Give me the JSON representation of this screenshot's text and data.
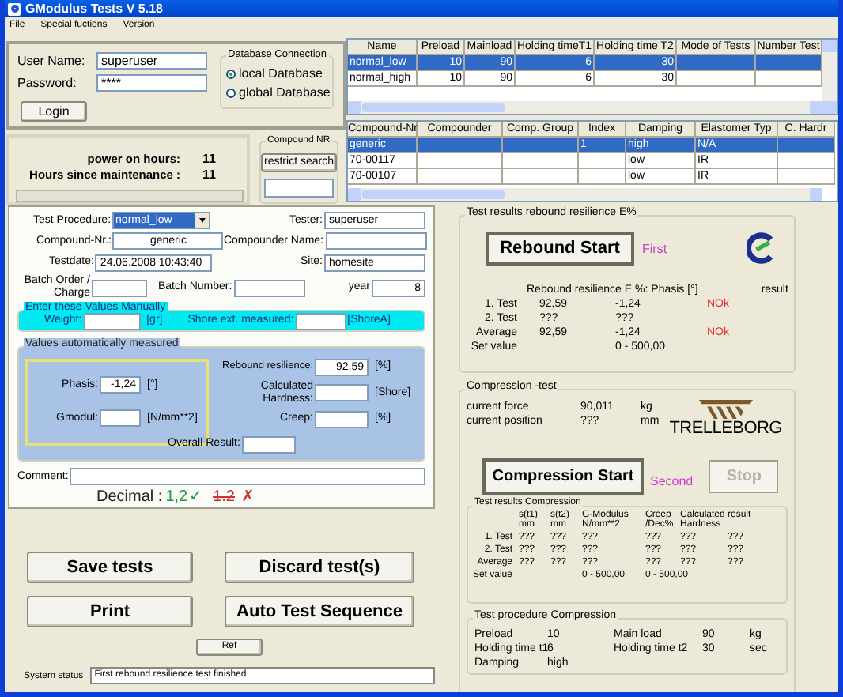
{
  "window": {
    "title": "GModulus Tests V 5.18"
  },
  "menu": [
    "File",
    "Special fuctions",
    "Version"
  ],
  "login": {
    "user_label": "User Name:",
    "user_value": "superuser",
    "password_label": "Password:",
    "password_value": "****",
    "button": "Login"
  },
  "database": {
    "title": "Database Connection",
    "options": [
      {
        "label": "local Database",
        "selected": true
      },
      {
        "label": "global Database",
        "selected": false
      }
    ]
  },
  "hours": [
    {
      "label": "power on hours:",
      "value": "11"
    },
    {
      "label": "Hours since maintenance :",
      "value": "11"
    }
  ],
  "compound_nr": {
    "title": "Compound NR",
    "button": "restrict search"
  },
  "procedures_table": {
    "columns": [
      "Name",
      "Preload",
      "Mainload",
      "Holding timeT1",
      "Holding time T2",
      "Mode of Tests",
      "Number Test"
    ],
    "rows": [
      {
        "cells": [
          "normal_low",
          "10",
          "90",
          "6",
          "30",
          null,
          null
        ],
        "selected": true
      },
      {
        "cells": [
          "normal_high",
          "10",
          "90",
          "6",
          "30",
          null,
          null
        ],
        "selected": false
      }
    ]
  },
  "compounds_table": {
    "columns": [
      "Compound-Nr",
      "Compounder",
      "Comp. Group",
      "Index",
      "Damping",
      "Elastomer Typ",
      "C. Hardr"
    ],
    "rows": [
      {
        "cells": [
          "generic",
          null,
          null,
          "1",
          "high",
          "N/A",
          null
        ],
        "selected": true
      },
      {
        "cells": [
          "70-00117",
          null,
          null,
          null,
          "low",
          "IR",
          null
        ],
        "selected": false
      },
      {
        "cells": [
          "70-00107",
          null,
          null,
          null,
          "low",
          "IR",
          null
        ],
        "selected": false
      }
    ]
  },
  "procedure_form": {
    "test_procedure": {
      "label": "Test Procedure:",
      "value": "normal_low"
    },
    "tester": {
      "label": "Tester:",
      "value": "superuser"
    },
    "compound_nr": {
      "label": "Compound-Nr.:",
      "value": "generic"
    },
    "compounder_name": {
      "label": "Compounder Name:"
    },
    "testdate": {
      "label": "Testdate:",
      "value": "24.06.2008 10:43:40"
    },
    "site": {
      "label": "Site:",
      "value": "homesite"
    },
    "batch_order": {
      "label": "Batch Order / Charge"
    },
    "batch_number": {
      "label": "Batch Number:"
    },
    "year": {
      "label": "year",
      "value": "8"
    }
  },
  "manual_values": {
    "title": "Enter these Values Manually",
    "weight_label": "Weight:",
    "weight_unit": "[gr]",
    "shore_label": "Shore ext. measured:",
    "shore_unit": "[ShoreA]"
  },
  "measured_values": {
    "title": "Values automatically measured",
    "phasis": {
      "label": "Phasis:",
      "value": "-1,24",
      "unit": "[°]"
    },
    "gmodul": {
      "label": "Gmodul:",
      "unit": "[N/mm**2]"
    },
    "rebound": {
      "label": "Rebound resilience:",
      "value": "92,59",
      "unit": "[%]"
    },
    "hardness": {
      "label": "Calculated Hardness:",
      "unit": "[Shore]"
    },
    "creep": {
      "label": "Creep:",
      "unit": "[%]"
    },
    "overall": {
      "label": "Overall Result:"
    }
  },
  "comment": {
    "label": "Comment:"
  },
  "decimal": {
    "label": "Decimal :",
    "good": "1,2",
    "good_mark": "✓",
    "bad": "1.2",
    "bad_mark": "✗"
  },
  "buttons": [
    "Save tests",
    "Discard test(s)",
    "Print",
    "Auto Test Sequence"
  ],
  "ref_button": "Ref",
  "status": {
    "label": "System status",
    "value": "First rebound resilience test finished"
  },
  "rebound_results": {
    "title": "Test results rebound resilience E%",
    "start_button": "Rebound Start",
    "step": "First",
    "columns": [
      "Rebound resilience E %:",
      "Phasis [°]",
      "result"
    ],
    "rows": [
      {
        "label": "1. Test",
        "cells": [
          "92,59",
          "-1,24",
          "NOk"
        ]
      },
      {
        "label": "2. Test",
        "cells": [
          "???",
          "???",
          null
        ]
      },
      {
        "label": "Average",
        "cells": [
          "92,59",
          "-1,24",
          "NOk"
        ]
      },
      {
        "label": "Set value",
        "cells": [
          null,
          "0 - 500,00",
          null
        ]
      }
    ]
  },
  "compression": {
    "title": "Compression -test",
    "readings": [
      {
        "label": "current force",
        "value": "90,011",
        "unit": "kg"
      },
      {
        "label": "current position",
        "value": "???",
        "unit": "mm"
      }
    ],
    "logo": "TRELLEBORG",
    "start_button": "Compression Start",
    "step": "Second",
    "stop_button": {
      "label": "Stop",
      "disabled": true
    }
  },
  "compression_results": {
    "title": "Test results Compression",
    "columns": [
      "s(t1) mm",
      "s(t2) mm",
      "G-Modulus N/mm**2",
      "Creep /Dec%",
      "Calculated Hardness",
      "result"
    ],
    "rows": [
      {
        "label": "1. Test",
        "cells": [
          "???",
          "???",
          "???",
          "???",
          "???",
          "???"
        ]
      },
      {
        "label": "2. Test",
        "cells": [
          "???",
          "???",
          "???",
          "???",
          "???",
          "???"
        ]
      },
      {
        "label": "Average",
        "cells": [
          "???",
          "???",
          "???",
          "???",
          "???",
          "???"
        ]
      },
      {
        "label": "Set value",
        "cells": [
          null,
          null,
          "0 - 500,00",
          "0 - 500,00",
          null,
          null
        ]
      }
    ]
  },
  "compression_procedure": {
    "title": "Test procedure Compression",
    "items": [
      {
        "label": "Preload",
        "value": "10"
      },
      {
        "label": "Main load",
        "value": "90",
        "unit": "kg"
      },
      {
        "label": "Holding time t1",
        "value": "6"
      },
      {
        "label": "Holding time t2",
        "value": "30",
        "unit": "sec"
      },
      {
        "label": "Damping",
        "value": "high"
      }
    ]
  }
}
